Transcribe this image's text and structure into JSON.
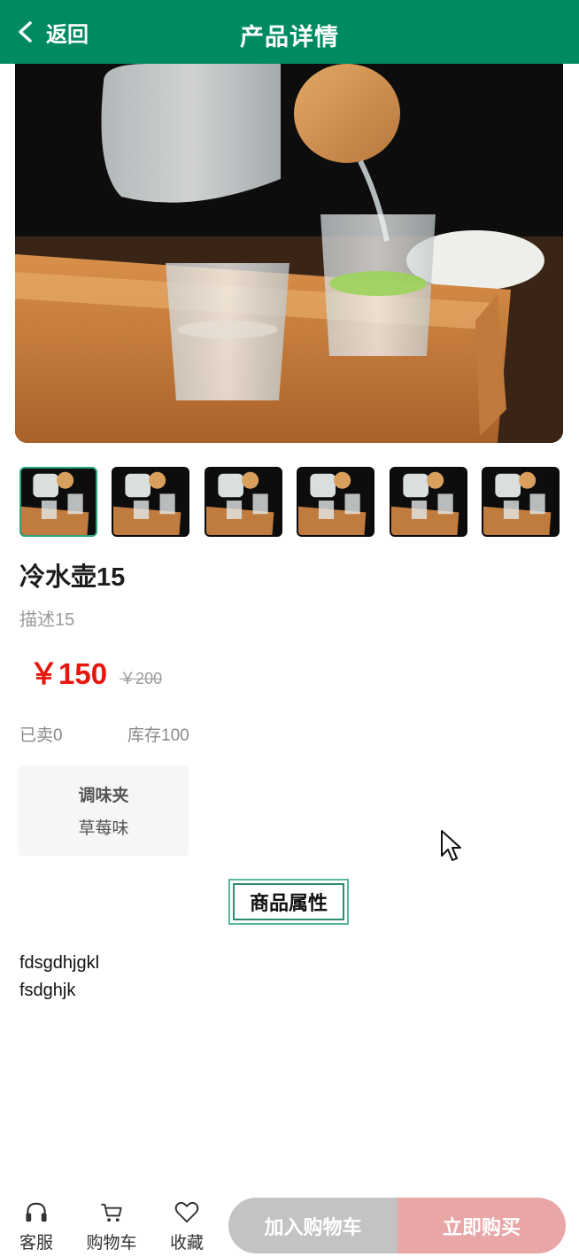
{
  "header": {
    "back_label": "返回",
    "title": "产品详情",
    "background_color": "#008a60"
  },
  "gallery": {
    "thumbnail_count": 6,
    "active_index": 0
  },
  "product": {
    "name": "冷水壶15",
    "description": "描述15",
    "price": "￥150",
    "original_price": "￥200",
    "sold": "已卖0",
    "stock": "库存100"
  },
  "spec": {
    "name": "调味夹",
    "value": "草莓味"
  },
  "attributes": {
    "tab_label": "商品属性",
    "lines": [
      "fdsgdhjgkl",
      "fsdghjk"
    ]
  },
  "bottom_bar": {
    "service_label": "客服",
    "cart_label": "购物车",
    "favorite_label": "收藏",
    "add_to_cart_label": "加入购物车",
    "buy_now_label": "立即购买",
    "icons": [
      "headset-icon",
      "cart-icon",
      "heart-icon"
    ]
  }
}
